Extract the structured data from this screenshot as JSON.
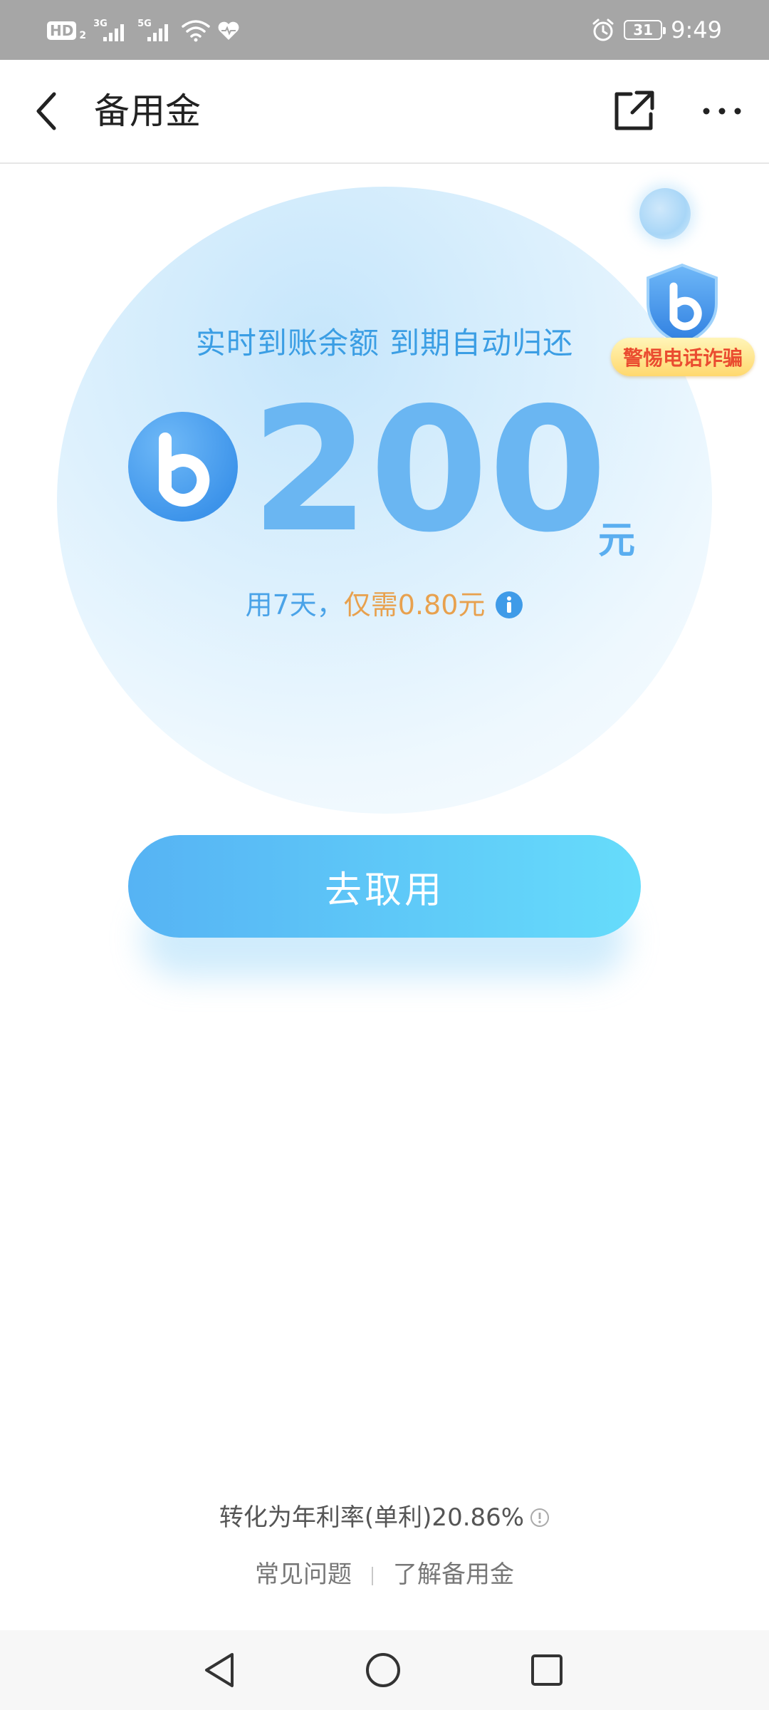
{
  "status_bar": {
    "hd_label": "HD",
    "hd_sub": "2",
    "net1": "3G",
    "net2": "5G",
    "battery": "31",
    "time": "9:49",
    "icons": [
      "signal-icon",
      "wifi-icon",
      "heart-icon",
      "alarm-icon",
      "battery-icon"
    ]
  },
  "header": {
    "title": "备用金",
    "icons": [
      "back-arrow-icon",
      "share-icon",
      "more-icon"
    ]
  },
  "hero": {
    "subtitle": "实时到账余额 到期自动归还",
    "amount": "200",
    "unit": "元",
    "fee_prefix": "用7天，",
    "fee_value": "仅需0.80元",
    "colors": {
      "accent": "#3b9ee4",
      "amount": "#6ab6f2",
      "fee": "#e8a14e"
    }
  },
  "fraud_badge": {
    "label": "警惕电话诈骗"
  },
  "cta": {
    "label": "去取用"
  },
  "footer": {
    "rate": "转化为年利率(单利)20.86%",
    "links": [
      "常见问题",
      "了解备用金"
    ]
  },
  "nav": {
    "icons": [
      "nav-back-icon",
      "nav-home-icon",
      "nav-recent-icon"
    ]
  }
}
